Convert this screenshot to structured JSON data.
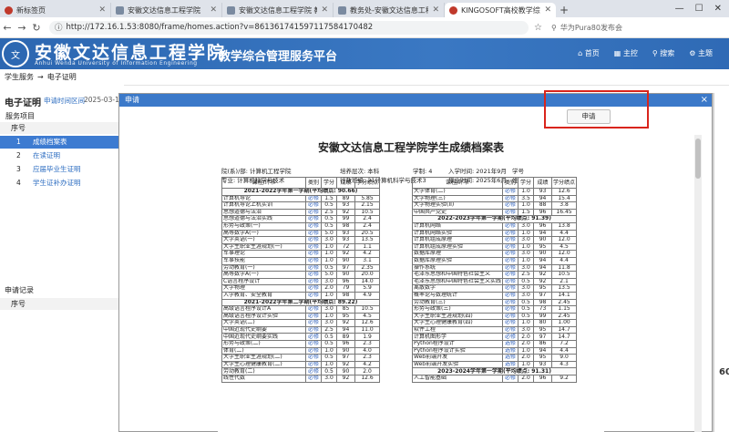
{
  "browser": {
    "tabs": [
      {
        "label": "新标签页",
        "favicon": "red"
      },
      {
        "label": "安徽文达信息工程学院",
        "favicon": "gray"
      },
      {
        "label": "安徽文达信息工程学院 教育",
        "favicon": "gray"
      },
      {
        "label": "教务处-安徽文达信息工程",
        "favicon": "gray"
      },
      {
        "label": "KINGOSOFT高校教学综合管",
        "favicon": "red"
      }
    ],
    "new_tab_label": "+",
    "url": "http://172.16.1.53:8080/frame/homes.action?v=861361741597117584170482",
    "extension_label": "华为Pura80发布会"
  },
  "header": {
    "logo_text": "文",
    "school_name": "安徽文达信息工程学院",
    "school_name_en": "Anhui Wenda University of Information Engineering",
    "platform": "教学综合管理服务平台",
    "nav": [
      {
        "icon": "home-icon",
        "glyph": "⌂",
        "label": "首页"
      },
      {
        "icon": "grid-icon",
        "glyph": "▦",
        "label": "主控"
      },
      {
        "icon": "search-icon",
        "glyph": "⚲",
        "label": "搜索"
      },
      {
        "icon": "gear-icon",
        "glyph": "⚙",
        "label": "主题"
      }
    ]
  },
  "breadcrumb": {
    "home": "学生服务",
    "arrow": "→",
    "current": "电子证明"
  },
  "left_panel": {
    "title": "电子证明",
    "apply_time_label": "申请时间区间",
    "apply_time_value": "2025-03-10",
    "section_label": "服务项目",
    "header_col": "序号",
    "items": [
      {
        "no": "1",
        "label": "成绩档案表"
      },
      {
        "no": "2",
        "label": "在读证明"
      },
      {
        "no": "3",
        "label": "应届毕业生证明"
      },
      {
        "no": "4",
        "label": "学生证补办证明"
      }
    ],
    "records_label": "申请记录",
    "records_header": "序号"
  },
  "modal": {
    "title": "申请",
    "close": "×",
    "print_button": "申请"
  },
  "document": {
    "title": "安徽文达信息工程学院学生成绩档案表",
    "info_line1": {
      "dept": "院(系)/部: 计算机工程学院",
      "level": "培养层次: 本科",
      "length": "学制: 4",
      "enroll": "入学时间: 2021年9月",
      "student_no": "学号"
    },
    "info_line2": {
      "major": "专业: 计算机科学与技术",
      "class": "行政班级: 21计算机科学与技术3",
      "graduate": "毕业时间: 2025年6月",
      "name": "姓"
    },
    "col_headers": [
      "课程/环节",
      "类别",
      "学分",
      "成绩",
      "学分绩点"
    ],
    "left_rows": [
      {
        "sem": "2021-2022学年第一学期(平均绩点: 90.66)"
      },
      {
        "c": [
          "计算机导论",
          "必修",
          "1.5",
          "89",
          "5.85"
        ]
      },
      {
        "c": [
          "计算机导论上机实训",
          "必修",
          "0.5",
          "93",
          "2.15"
        ]
      },
      {
        "c": [
          "思想道德与法治",
          "必修",
          "2.5",
          "92",
          "10.5"
        ]
      },
      {
        "c": [
          "思想道德与法治实践",
          "必修",
          "0.5",
          "99",
          "2.4"
        ]
      },
      {
        "c": [
          "形势与政策(一)",
          "必修",
          "0.5",
          "98",
          "2.4"
        ]
      },
      {
        "c": [
          "高等数学A(一)",
          "必修",
          "5.0",
          "93",
          "20.5"
        ]
      },
      {
        "c": [
          "大学英语(一)",
          "必修",
          "3.0",
          "93",
          "13.5"
        ]
      },
      {
        "c": [
          "大学生职业生涯规划(一)",
          "必修",
          "1.0",
          "72",
          "1.1"
        ]
      },
      {
        "c": [
          "军事理论",
          "必修",
          "1.0",
          "92",
          "4.2"
        ]
      },
      {
        "c": [
          "军事技能",
          "必修",
          "1.0",
          "90",
          "3.1"
        ]
      },
      {
        "c": [
          "劳动教育(一)",
          "必修",
          "0.5",
          "97",
          "2.35"
        ]
      },
      {
        "c": [
          "高等数学A(一)",
          "必修",
          "5.0",
          "90",
          "20.0"
        ]
      },
      {
        "c": [
          "C语言程序设计",
          "必修",
          "3.0",
          "96",
          "14.0"
        ]
      },
      {
        "c": [
          "大学物理",
          "必修",
          "2.0",
          "79",
          "5.9"
        ]
      },
      {
        "c": [
          "入学教育、安全教育",
          "必修",
          "1.0",
          "98",
          "4.9"
        ]
      },
      {
        "sem": "2021-2022学年第二学期(平均绩点: 89.22)"
      },
      {
        "c": [
          "高级语言程序设计A",
          "必修",
          "3.0",
          "85",
          "10.5"
        ]
      },
      {
        "c": [
          "高级语言程序设计实验",
          "必修",
          "1.0",
          "95",
          "4.5"
        ]
      },
      {
        "c": [
          "大学英语(二)",
          "必修",
          "3.0",
          "92",
          "12.6"
        ]
      },
      {
        "c": [
          "中国近现代史纲要",
          "必修",
          "2.5",
          "94",
          "11.0"
        ]
      },
      {
        "c": [
          "中国近现代史纲要实践",
          "必修",
          "0.5",
          "89",
          "1.9"
        ]
      },
      {
        "c": [
          "形势与政策(二)",
          "必修",
          "0.5",
          "96",
          "2.3"
        ]
      },
      {
        "c": [
          "体育(二)",
          "必修",
          "1.0",
          "90",
          "4.0"
        ]
      },
      {
        "c": [
          "大学生职业生涯规划(二)",
          "必修",
          "0.5",
          "97",
          "2.3"
        ]
      },
      {
        "c": [
          "大学生心理健康教育(二)",
          "必修",
          "1.0",
          "92",
          "4.2"
        ]
      },
      {
        "c": [
          "劳动教育(二)",
          "必修",
          "0.5",
          "90",
          "2.0"
        ]
      },
      {
        "c": [
          "线性代数",
          "必修",
          "3.0",
          "92",
          "12.6"
        ]
      }
    ],
    "right_rows": [
      {
        "c": [
          "大学体育(二)",
          "必修",
          "1.0",
          "93",
          "12.6"
        ]
      },
      {
        "c": [
          "大学物理(三)",
          "必修",
          "3.5",
          "94",
          "15.4"
        ]
      },
      {
        "c": [
          "大学物理实验(II)",
          "必修",
          "1.0",
          "88",
          "3.8"
        ]
      },
      {
        "c": [
          "中国共产党史",
          "必修",
          "1.5",
          "96",
          "16.45"
        ]
      },
      {
        "sem": "2022-2023学年第一学期(平均绩点: 91.39)"
      },
      {
        "c": [
          "计算机网络",
          "必修",
          "3.0",
          "96",
          "13.8"
        ]
      },
      {
        "c": [
          "计算机网络实验",
          "必修",
          "1.0",
          "94",
          "4.4"
        ]
      },
      {
        "c": [
          "计算机组成原理",
          "必修",
          "3.0",
          "90",
          "12.0"
        ]
      },
      {
        "c": [
          "计算机组成原理实验",
          "必修",
          "1.0",
          "95",
          "4.5"
        ]
      },
      {
        "c": [
          "数据库原理",
          "必修",
          "3.0",
          "90",
          "12.0"
        ]
      },
      {
        "c": [
          "数据库原理实验",
          "必修",
          "1.0",
          "94",
          "4.4"
        ]
      },
      {
        "c": [
          "操作系统",
          "必修",
          "3.0",
          "94",
          "11.8"
        ]
      },
      {
        "c": [
          "毛泽东思想和中国特色社会主义",
          "必修",
          "2.5",
          "92",
          "10.5"
        ]
      },
      {
        "c": [
          "毛泽东思想和中国特色社会主义实践",
          "必修",
          "0.5",
          "92",
          "2.1"
        ]
      },
      {
        "c": [
          "离散数学",
          "必修",
          "3.0",
          "95",
          "13.5"
        ]
      },
      {
        "c": [
          "概率论与数理统计",
          "必修",
          "3.0",
          "97",
          "14.1"
        ]
      },
      {
        "c": [
          "劳动教育(三)",
          "必修",
          "0.5",
          "98",
          "2.45"
        ]
      },
      {
        "c": [
          "形势与政策(三)",
          "必修",
          "0.5",
          "73",
          "1.15"
        ]
      },
      {
        "c": [
          "大学生职业生涯规划(四)",
          "必修",
          "0.5",
          "99",
          "2.45"
        ]
      },
      {
        "c": [
          "大学生心理健康教育(四)",
          "必修",
          "1.0",
          "80",
          "1.00"
        ]
      },
      {
        "c": [
          "软件工程",
          "必修",
          "3.0",
          "95",
          "14.7"
        ]
      },
      {
        "c": [
          "计算机图形学",
          "必修",
          "2.0",
          "97",
          "14.7"
        ]
      },
      {
        "c": [
          "Python程序设计",
          "选修",
          "2.0",
          "86",
          "7.2"
        ]
      },
      {
        "c": [
          "Python程序设计实验",
          "选修",
          "1.0",
          "94",
          "4.4"
        ]
      },
      {
        "c": [
          "Web前端开发",
          "选修",
          "2.0",
          "95",
          "9.0"
        ]
      },
      {
        "c": [
          "Web前端开发实验",
          "选修",
          "1.0",
          "93",
          "4.3"
        ]
      },
      {
        "sem": "2023-2024学年第一学期(平均绩点: 91.31)"
      },
      {
        "c": [
          "人工智能基础",
          "必修",
          "2.0",
          "96",
          "9.2"
        ]
      }
    ]
  },
  "page_badge": "60"
}
